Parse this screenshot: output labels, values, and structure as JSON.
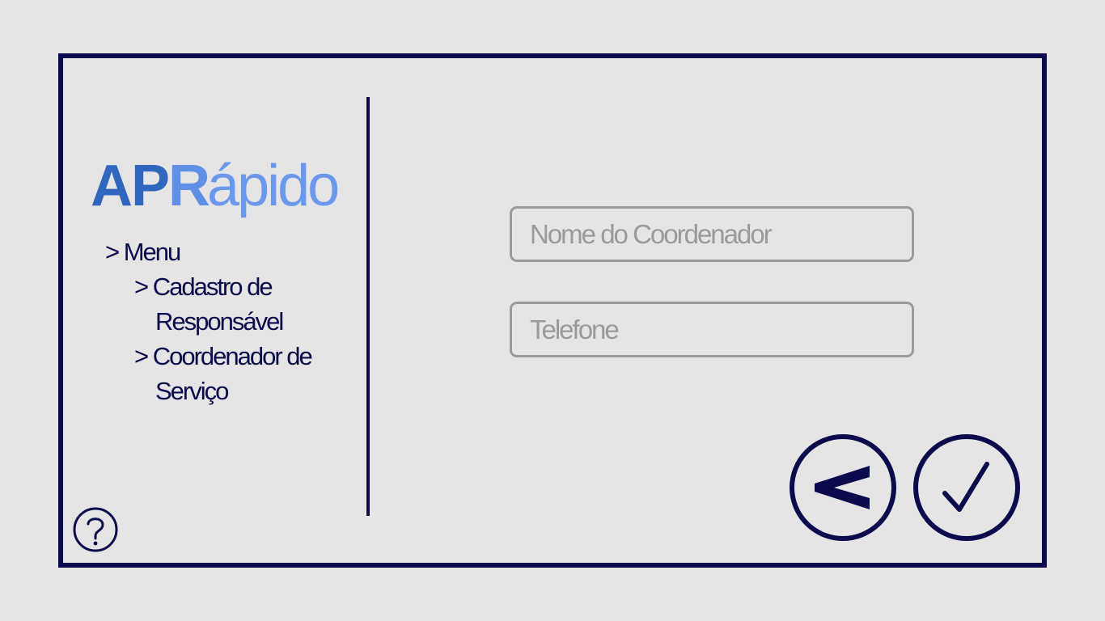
{
  "app": {
    "logo_part1": "AP",
    "logo_part2": "R",
    "logo_part3": "ápido"
  },
  "menu": {
    "root_label": "> Menu",
    "items": [
      {
        "lines": [
          "> Cadastro de",
          "Responsável"
        ]
      },
      {
        "lines": [
          "> Coordenador de",
          "Serviço"
        ]
      }
    ]
  },
  "form": {
    "coordinator_name": {
      "value": "",
      "placeholder": "Nome do Coordenador"
    },
    "phone": {
      "value": "",
      "placeholder": "Telefone"
    }
  },
  "icons": {
    "help": "question-circle-icon",
    "back": "chevron-left-icon",
    "confirm": "checkmark-icon"
  },
  "colors": {
    "frame": "#0a0a4d",
    "background": "#e5e5e5",
    "logo_dark": "#2f67bf",
    "logo_light": "#6a98ec",
    "field_border": "#9a9a9a"
  }
}
